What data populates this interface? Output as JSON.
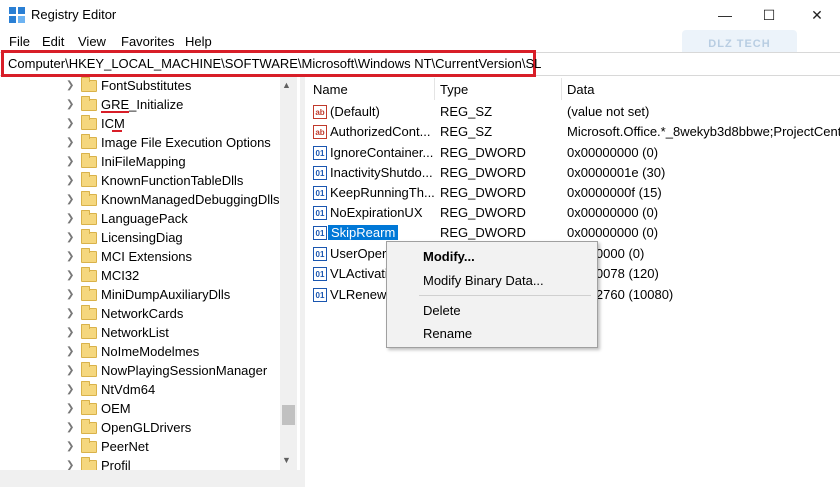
{
  "window": {
    "title": "Registry Editor",
    "minimize_glyph": "—",
    "maximize_glyph": "☐",
    "close_glyph": "✕",
    "app_icon": "registry-icon"
  },
  "menu": [
    "File",
    "Edit",
    "View",
    "Favorites",
    "Help"
  ],
  "address": "Computer\\HKEY_LOCAL_MACHINE\\SOFTWARE\\Microsoft\\Windows NT\\CurrentVersion\\SL",
  "watermark": "DLZ TECH",
  "colors": {
    "highlight_border": "#d81e28",
    "selection": "#0078d7",
    "folder": "#f5d77e"
  },
  "tree": [
    "FontSubstitutes",
    "GRE_Initialize",
    "ICM",
    "Image File Execution Options",
    "IniFileMapping",
    "KnownFunctionTableDlls",
    "KnownManagedDebuggingDlls",
    "LanguagePack",
    "LicensingDiag",
    "MCI Extensions",
    "MCI32",
    "MiniDumpAuxiliaryDlls",
    "NetworkCards",
    "NetworkList",
    "NoImeModelmes",
    "NowPlayingSessionManager",
    "NtVdm64",
    "OEM",
    "OpenGLDrivers",
    "PeerNet",
    "Profil"
  ],
  "list": {
    "headers": {
      "name": "Name",
      "type": "Type",
      "data": "Data"
    },
    "rows": [
      {
        "name": "(Default)",
        "type": "REG_SZ",
        "data": "(value not set)",
        "icon": "ab"
      },
      {
        "name": "AuthorizedCont...",
        "type": "REG_SZ",
        "data": "Microsoft.Office.*_8wekyb3d8bbwe;ProjectCente",
        "icon": "ab"
      },
      {
        "name": "IgnoreContainer...",
        "type": "REG_DWORD",
        "data": "0x00000000 (0)",
        "icon": "dw"
      },
      {
        "name": "InactivityShutdo...",
        "type": "REG_DWORD",
        "data": "0x0000001e (30)",
        "icon": "dw"
      },
      {
        "name": "KeepRunningTh...",
        "type": "REG_DWORD",
        "data": "0x0000000f (15)",
        "icon": "dw"
      },
      {
        "name": "NoExpirationUX",
        "type": "REG_DWORD",
        "data": "0x00000000 (0)",
        "icon": "dw"
      },
      {
        "name": "SkipRearm",
        "type": "REG_DWORD",
        "data": "0x00000000 (0)",
        "icon": "dw"
      },
      {
        "name": "UserOpera",
        "type": "",
        "data": "00000000 (0)",
        "icon": "dw"
      },
      {
        "name": "VLActivati",
        "type": "",
        "data": "00000078 (120)",
        "icon": "dw"
      },
      {
        "name": "VLRenewa",
        "type": "",
        "data": "00002760 (10080)",
        "icon": "dw"
      }
    ]
  },
  "context_menu": {
    "modify": "Modify...",
    "modify_binary": "Modify Binary Data...",
    "delete": "Delete",
    "rename": "Rename"
  }
}
